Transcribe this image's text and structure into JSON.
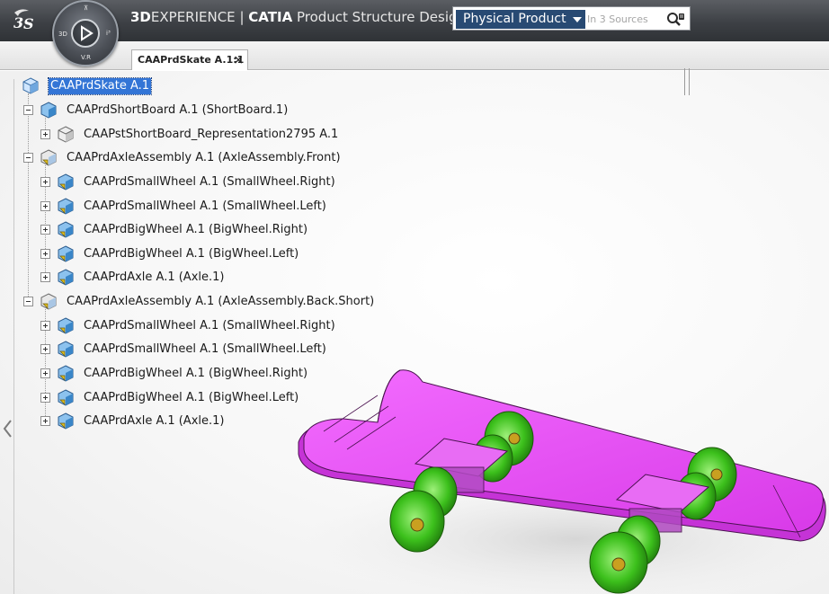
{
  "header": {
    "brand_prefix": "3D",
    "brand_experience": "EXPERIENCE",
    "brand_sep": "|",
    "brand_catia": "CATIA",
    "brand_app": "Product Structure Design",
    "compass_labels": {
      "top": "⊼",
      "left": "3D",
      "right": "i³",
      "bottom": "V.R"
    }
  },
  "search": {
    "scope": "Physical Product",
    "placeholder": "In 3 Sources"
  },
  "document_tab": {
    "label": "CAAPrdSkate A.1:1",
    "close": "×"
  },
  "tree": {
    "root": "CAAPrdSkate A.1",
    "nodes": [
      {
        "label": "CAAPrdShortBoard A.1 (ShortBoard.1)",
        "icon": "product-icon"
      },
      {
        "label": "CAAPstShortBoard_Representation2795 A.1",
        "icon": "representation-icon"
      },
      {
        "label": "CAAPrdAxleAssembly A.1 (AxleAssembly.Front)",
        "icon": "assembly-icon"
      },
      {
        "label": "CAAPrdSmallWheel A.1 (SmallWheel.Right)",
        "icon": "part-icon"
      },
      {
        "label": "CAAPrdSmallWheel A.1 (SmallWheel.Left)",
        "icon": "part-icon"
      },
      {
        "label": "CAAPrdBigWheel A.1 (BigWheel.Right)",
        "icon": "part-icon"
      },
      {
        "label": "CAAPrdBigWheel A.1 (BigWheel.Left)",
        "icon": "part-icon"
      },
      {
        "label": "CAAPrdAxle A.1 (Axle.1)",
        "icon": "part-icon"
      },
      {
        "label": "CAAPrdAxleAssembly A.1 (AxleAssembly.Back.Short)",
        "icon": "assembly-icon"
      },
      {
        "label": "CAAPrdSmallWheel A.1 (SmallWheel.Right)",
        "icon": "part-icon"
      },
      {
        "label": "CAAPrdSmallWheel A.1 (SmallWheel.Left)",
        "icon": "part-icon"
      },
      {
        "label": "CAAPrdBigWheel A.1 (BigWheel.Right)",
        "icon": "part-icon"
      },
      {
        "label": "CAAPrdBigWheel A.1 (BigWheel.Left)",
        "icon": "part-icon"
      },
      {
        "label": "CAAPrdAxle A.1 (Axle.1)",
        "icon": "part-icon"
      }
    ]
  },
  "colors": {
    "header_bg": "#3d4045",
    "search_scope_bg": "#284a73",
    "selection": "#3375d6",
    "board": "#e040f0",
    "wheels": "#3cc01c",
    "trucks": "#8a4aa0"
  }
}
